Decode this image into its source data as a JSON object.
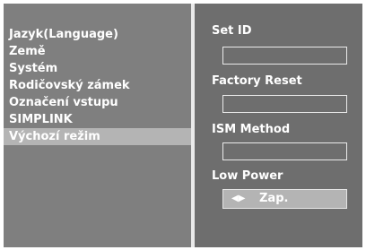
{
  "menu": {
    "items": [
      {
        "label": "Jazyk(Language)",
        "selected": false
      },
      {
        "label": "Země",
        "selected": false
      },
      {
        "label": "Systém",
        "selected": false
      },
      {
        "label": "Rodičovský zámek",
        "selected": false
      },
      {
        "label": "Označení vstupu",
        "selected": false
      },
      {
        "label": "SIMPLINK",
        "selected": false
      },
      {
        "label": "Výchozí režim",
        "selected": true
      }
    ]
  },
  "settings": {
    "set_id_label": "Set ID",
    "set_id_value": "",
    "factory_reset_label": "Factory Reset",
    "factory_reset_value": "",
    "ism_method_label": "ISM Method",
    "ism_method_value": "",
    "low_power_label": "Low Power",
    "low_power_value": "Zap.",
    "low_power_arrows": "◀▶"
  },
  "icons": {
    "selector_arrows": "left-right-arrows-icon"
  },
  "colors": {
    "panel_bg": "#7f7f7f",
    "right_panel_bg": "#6e6e6e",
    "highlight": "#b4b4b4",
    "text": "#ffffff"
  }
}
